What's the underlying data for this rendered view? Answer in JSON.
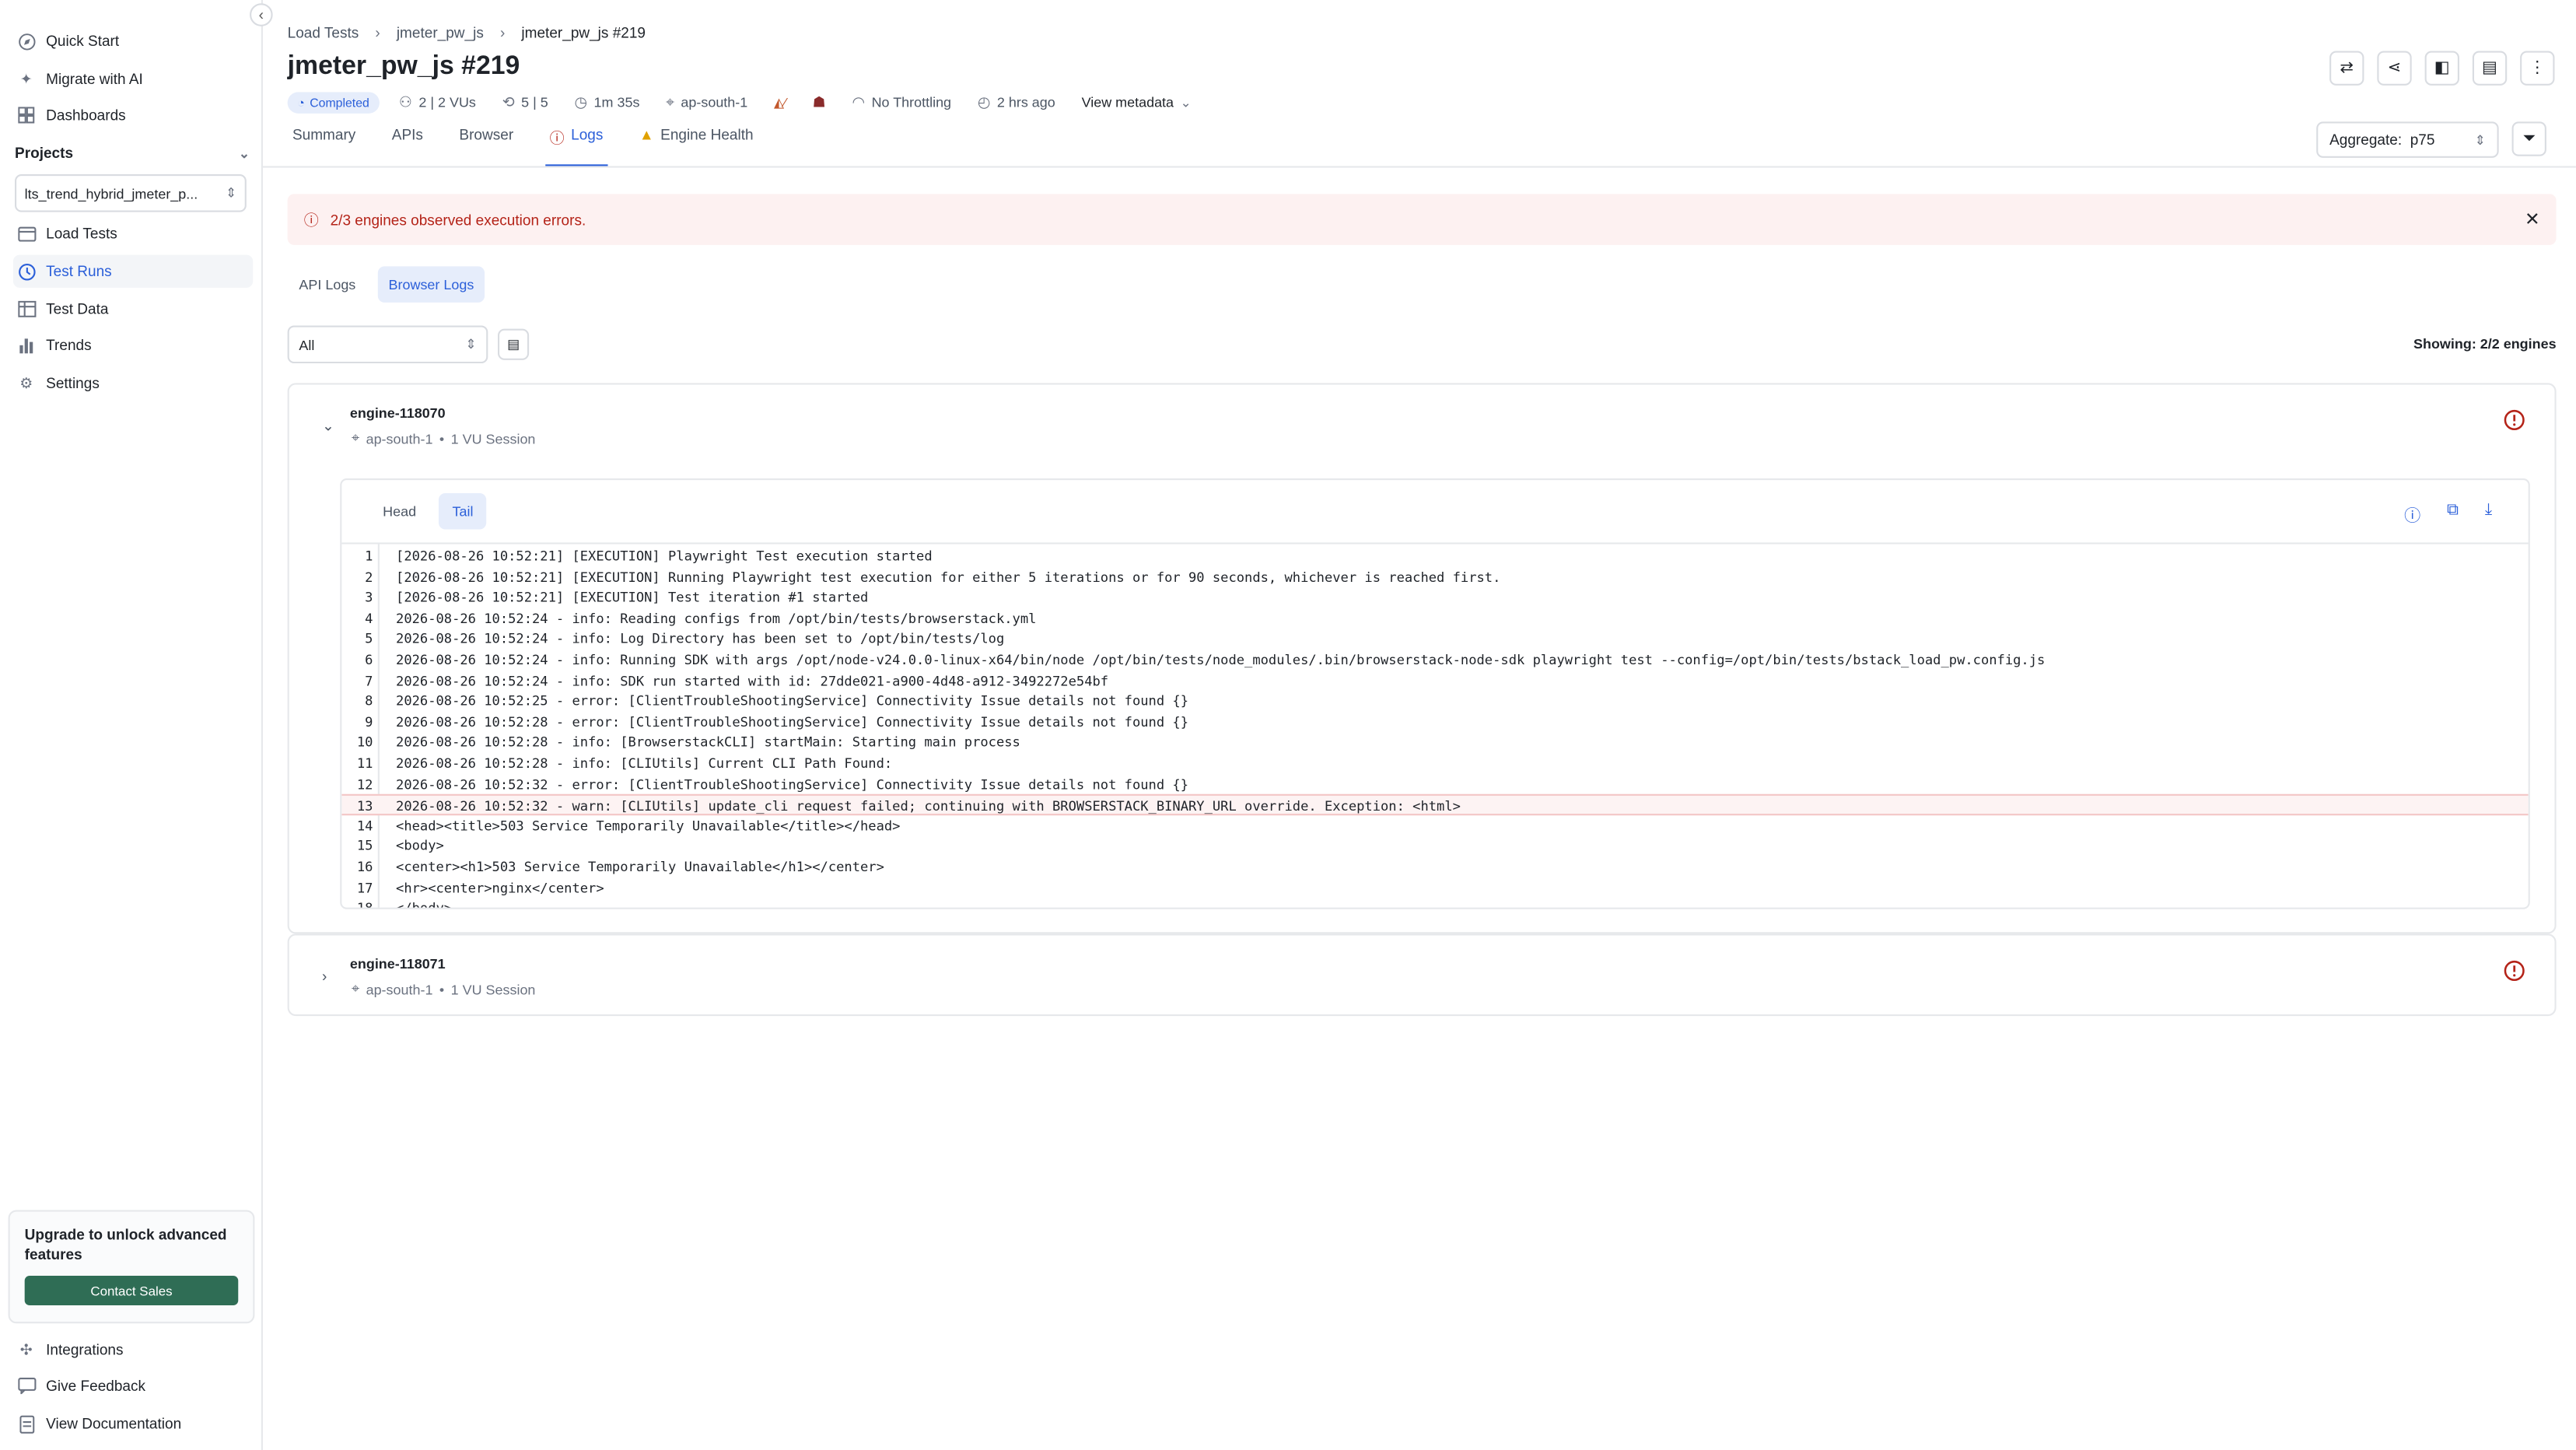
{
  "sidebar": {
    "top_items": [
      {
        "label": "Quick Start",
        "icon": "compass-icon"
      },
      {
        "label": "Migrate with AI",
        "icon": "sparkle-icon"
      },
      {
        "label": "Dashboards",
        "icon": "dashboard-icon"
      }
    ],
    "projects_label": "Projects",
    "project_selected": "lts_trend_hybrid_jmeter_p...",
    "project_items": [
      {
        "label": "Load Tests",
        "icon": "load-tests-icon",
        "active": false
      },
      {
        "label": "Test Runs",
        "icon": "test-runs-icon",
        "active": true
      },
      {
        "label": "Test Data",
        "icon": "table-icon",
        "active": false
      },
      {
        "label": "Trends",
        "icon": "bar-chart-icon",
        "active": false
      },
      {
        "label": "Settings",
        "icon": "gear-icon",
        "active": false
      }
    ],
    "upgrade_text": "Upgrade to unlock advanced features",
    "contact_sales": "Contact Sales",
    "bottom_items": [
      {
        "label": "Integrations",
        "icon": "puzzle-icon"
      },
      {
        "label": "Give Feedback",
        "icon": "feedback-icon"
      },
      {
        "label": "View Documentation",
        "icon": "document-icon"
      }
    ]
  },
  "breadcrumb": [
    "Load Tests",
    "jmeter_pw_js",
    "jmeter_pw_js #219"
  ],
  "title": "jmeter_pw_js #219",
  "meta": {
    "status": "Completed",
    "vus": "2 | 2 VUs",
    "iterations": "5 | 5",
    "duration": "1m 35s",
    "region": "ap-south-1",
    "throttling": "No Throttling",
    "time_ago": "2 hrs ago",
    "view_metadata": "View metadata"
  },
  "tabs": [
    {
      "label": "Summary",
      "active": false
    },
    {
      "label": "APIs",
      "active": false
    },
    {
      "label": "Browser",
      "active": false
    },
    {
      "label": "Logs",
      "active": true
    },
    {
      "label": "Engine Health",
      "active": false
    }
  ],
  "aggregate": {
    "label": "Aggregate:",
    "value": "p75"
  },
  "alert": "2/3 engines observed execution errors.",
  "log_tabs": [
    "API Logs",
    "Browser Logs"
  ],
  "log_filter": "All",
  "showing": "Showing: 2/2 engines",
  "engines": [
    {
      "name": "engine-118070",
      "region": "ap-south-1",
      "session": "1 VU Session",
      "expanded": true
    },
    {
      "name": "engine-118071",
      "region": "ap-south-1",
      "session": "1 VU Session",
      "expanded": false
    }
  ],
  "log_view_tabs": [
    "Head",
    "Tail"
  ],
  "log_lines": [
    "[2026-08-26 10:52:21] [EXECUTION] Playwright Test execution started",
    "[2026-08-26 10:52:21] [EXECUTION] Running Playwright test execution for either 5 iterations or for 90 seconds, whichever is reached first.",
    "[2026-08-26 10:52:21] [EXECUTION] Test iteration #1 started",
    "2026-08-26 10:52:24 - info: Reading configs from /opt/bin/tests/browserstack.yml",
    "2026-08-26 10:52:24 - info: Log Directory has been set to /opt/bin/tests/log",
    "2026-08-26 10:52:24 - info: Running SDK with args /opt/node-v24.0.0-linux-x64/bin/node /opt/bin/tests/node_modules/.bin/browserstack-node-sdk playwright test --config=/opt/bin/tests/bstack_load_pw.config.js",
    "2026-08-26 10:52:24 - info: SDK run started with id: 27dde021-a900-4d48-a912-3492272e54bf",
    "2026-08-26 10:52:25 - error: [ClientTroubleShootingService] Connectivity Issue details not found {}",
    "2026-08-26 10:52:28 - error: [ClientTroubleShootingService] Connectivity Issue details not found {}",
    "2026-08-26 10:52:28 - info: [BrowserstackCLI] startMain: Starting main process",
    "2026-08-26 10:52:28 - info: [CLIUtils] Current CLI Path Found:",
    "2026-08-26 10:52:32 - error: [ClientTroubleShootingService] Connectivity Issue details not found {}",
    "2026-08-26 10:52:32 - warn: [CLIUtils] update_cli request failed; continuing with BROWSERSTACK_BINARY_URL override. Exception: <html>",
    "<head><title>503 Service Temporarily Unavailable</title></head>",
    "<body>",
    "<center><h1>503 Service Temporarily Unavailable</h1></center>",
    "<hr><center>nginx</center>",
    "</body>"
  ],
  "highlight_line": 13,
  "colors": {
    "accent": "#2b5fd9",
    "error": "#b42318",
    "success_btn": "#2f6d55"
  }
}
